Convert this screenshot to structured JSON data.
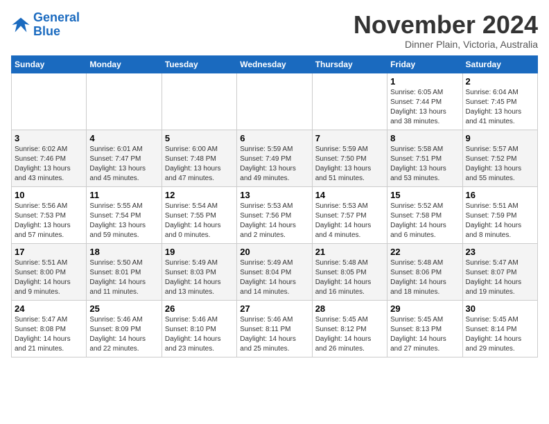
{
  "header": {
    "logo_line1": "General",
    "logo_line2": "Blue",
    "month_title": "November 2024",
    "subtitle": "Dinner Plain, Victoria, Australia"
  },
  "weekdays": [
    "Sunday",
    "Monday",
    "Tuesday",
    "Wednesday",
    "Thursday",
    "Friday",
    "Saturday"
  ],
  "weeks": [
    [
      {
        "day": "",
        "info": ""
      },
      {
        "day": "",
        "info": ""
      },
      {
        "day": "",
        "info": ""
      },
      {
        "day": "",
        "info": ""
      },
      {
        "day": "",
        "info": ""
      },
      {
        "day": "1",
        "info": "Sunrise: 6:05 AM\nSunset: 7:44 PM\nDaylight: 13 hours\nand 38 minutes."
      },
      {
        "day": "2",
        "info": "Sunrise: 6:04 AM\nSunset: 7:45 PM\nDaylight: 13 hours\nand 41 minutes."
      }
    ],
    [
      {
        "day": "3",
        "info": "Sunrise: 6:02 AM\nSunset: 7:46 PM\nDaylight: 13 hours\nand 43 minutes."
      },
      {
        "day": "4",
        "info": "Sunrise: 6:01 AM\nSunset: 7:47 PM\nDaylight: 13 hours\nand 45 minutes."
      },
      {
        "day": "5",
        "info": "Sunrise: 6:00 AM\nSunset: 7:48 PM\nDaylight: 13 hours\nand 47 minutes."
      },
      {
        "day": "6",
        "info": "Sunrise: 5:59 AM\nSunset: 7:49 PM\nDaylight: 13 hours\nand 49 minutes."
      },
      {
        "day": "7",
        "info": "Sunrise: 5:59 AM\nSunset: 7:50 PM\nDaylight: 13 hours\nand 51 minutes."
      },
      {
        "day": "8",
        "info": "Sunrise: 5:58 AM\nSunset: 7:51 PM\nDaylight: 13 hours\nand 53 minutes."
      },
      {
        "day": "9",
        "info": "Sunrise: 5:57 AM\nSunset: 7:52 PM\nDaylight: 13 hours\nand 55 minutes."
      }
    ],
    [
      {
        "day": "10",
        "info": "Sunrise: 5:56 AM\nSunset: 7:53 PM\nDaylight: 13 hours\nand 57 minutes."
      },
      {
        "day": "11",
        "info": "Sunrise: 5:55 AM\nSunset: 7:54 PM\nDaylight: 13 hours\nand 59 minutes."
      },
      {
        "day": "12",
        "info": "Sunrise: 5:54 AM\nSunset: 7:55 PM\nDaylight: 14 hours\nand 0 minutes."
      },
      {
        "day": "13",
        "info": "Sunrise: 5:53 AM\nSunset: 7:56 PM\nDaylight: 14 hours\nand 2 minutes."
      },
      {
        "day": "14",
        "info": "Sunrise: 5:53 AM\nSunset: 7:57 PM\nDaylight: 14 hours\nand 4 minutes."
      },
      {
        "day": "15",
        "info": "Sunrise: 5:52 AM\nSunset: 7:58 PM\nDaylight: 14 hours\nand 6 minutes."
      },
      {
        "day": "16",
        "info": "Sunrise: 5:51 AM\nSunset: 7:59 PM\nDaylight: 14 hours\nand 8 minutes."
      }
    ],
    [
      {
        "day": "17",
        "info": "Sunrise: 5:51 AM\nSunset: 8:00 PM\nDaylight: 14 hours\nand 9 minutes."
      },
      {
        "day": "18",
        "info": "Sunrise: 5:50 AM\nSunset: 8:01 PM\nDaylight: 14 hours\nand 11 minutes."
      },
      {
        "day": "19",
        "info": "Sunrise: 5:49 AM\nSunset: 8:03 PM\nDaylight: 14 hours\nand 13 minutes."
      },
      {
        "day": "20",
        "info": "Sunrise: 5:49 AM\nSunset: 8:04 PM\nDaylight: 14 hours\nand 14 minutes."
      },
      {
        "day": "21",
        "info": "Sunrise: 5:48 AM\nSunset: 8:05 PM\nDaylight: 14 hours\nand 16 minutes."
      },
      {
        "day": "22",
        "info": "Sunrise: 5:48 AM\nSunset: 8:06 PM\nDaylight: 14 hours\nand 18 minutes."
      },
      {
        "day": "23",
        "info": "Sunrise: 5:47 AM\nSunset: 8:07 PM\nDaylight: 14 hours\nand 19 minutes."
      }
    ],
    [
      {
        "day": "24",
        "info": "Sunrise: 5:47 AM\nSunset: 8:08 PM\nDaylight: 14 hours\nand 21 minutes."
      },
      {
        "day": "25",
        "info": "Sunrise: 5:46 AM\nSunset: 8:09 PM\nDaylight: 14 hours\nand 22 minutes."
      },
      {
        "day": "26",
        "info": "Sunrise: 5:46 AM\nSunset: 8:10 PM\nDaylight: 14 hours\nand 23 minutes."
      },
      {
        "day": "27",
        "info": "Sunrise: 5:46 AM\nSunset: 8:11 PM\nDaylight: 14 hours\nand 25 minutes."
      },
      {
        "day": "28",
        "info": "Sunrise: 5:45 AM\nSunset: 8:12 PM\nDaylight: 14 hours\nand 26 minutes."
      },
      {
        "day": "29",
        "info": "Sunrise: 5:45 AM\nSunset: 8:13 PM\nDaylight: 14 hours\nand 27 minutes."
      },
      {
        "day": "30",
        "info": "Sunrise: 5:45 AM\nSunset: 8:14 PM\nDaylight: 14 hours\nand 29 minutes."
      }
    ]
  ]
}
